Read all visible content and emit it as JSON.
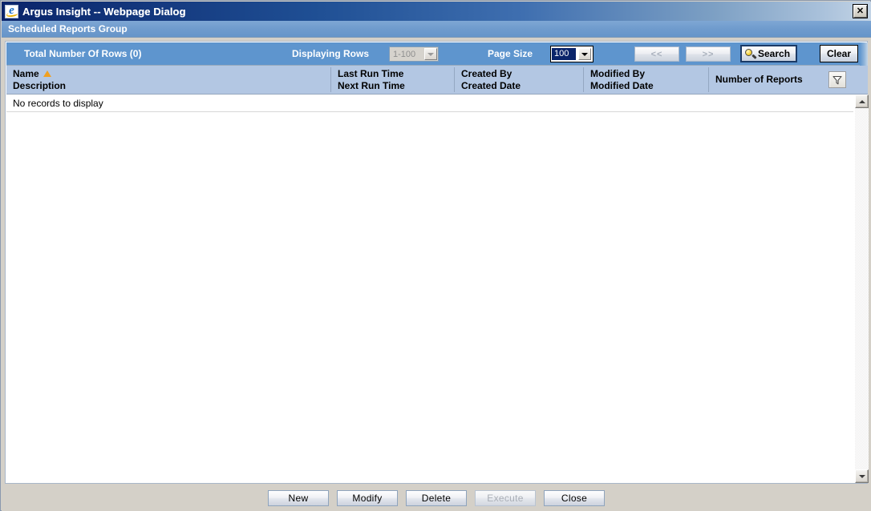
{
  "window": {
    "title": "Argus Insight -- Webpage Dialog",
    "icon": "internet-explorer-icon",
    "close_label": "✕",
    "page_heading": "Scheduled Reports Group"
  },
  "toolbar": {
    "total_rows_label": "Total Number Of Rows (0)",
    "displaying_rows_label": "Displaying Rows",
    "displaying_rows_value": "1-100",
    "page_size_label": "Page Size",
    "page_size_value": "100",
    "prev_page_label": "<<",
    "next_page_label": ">>",
    "search_label": "Search",
    "clear_label": "Clear",
    "accent_color": "#5e95ce"
  },
  "grid": {
    "header_bg": "#b3c7e3",
    "sort_indicator_color": "#f0a020",
    "columns": [
      {
        "line1": "Name",
        "line2": "Description",
        "sorted": "ascending"
      },
      {
        "line1": "Last Run Time",
        "line2": "Next Run Time",
        "sorted": "none"
      },
      {
        "line1": "Created By",
        "line2": "Created Date",
        "sorted": "none"
      },
      {
        "line1": "Modified By",
        "line2": "Modified Date",
        "sorted": "none"
      },
      {
        "line1": "Number of Reports",
        "line2": "",
        "sorted": "none"
      }
    ],
    "filter_icon": "funnel-icon",
    "empty_message": "No records to display",
    "rows": []
  },
  "scrollbar": {
    "up_icon": "triangle-up-icon",
    "down_icon": "triangle-down-icon"
  },
  "footer": {
    "buttons": [
      {
        "label": "New",
        "disabled": false
      },
      {
        "label": "Modify",
        "disabled": false
      },
      {
        "label": "Delete",
        "disabled": false
      },
      {
        "label": "Execute",
        "disabled": true
      },
      {
        "label": "Close",
        "disabled": false
      }
    ]
  }
}
